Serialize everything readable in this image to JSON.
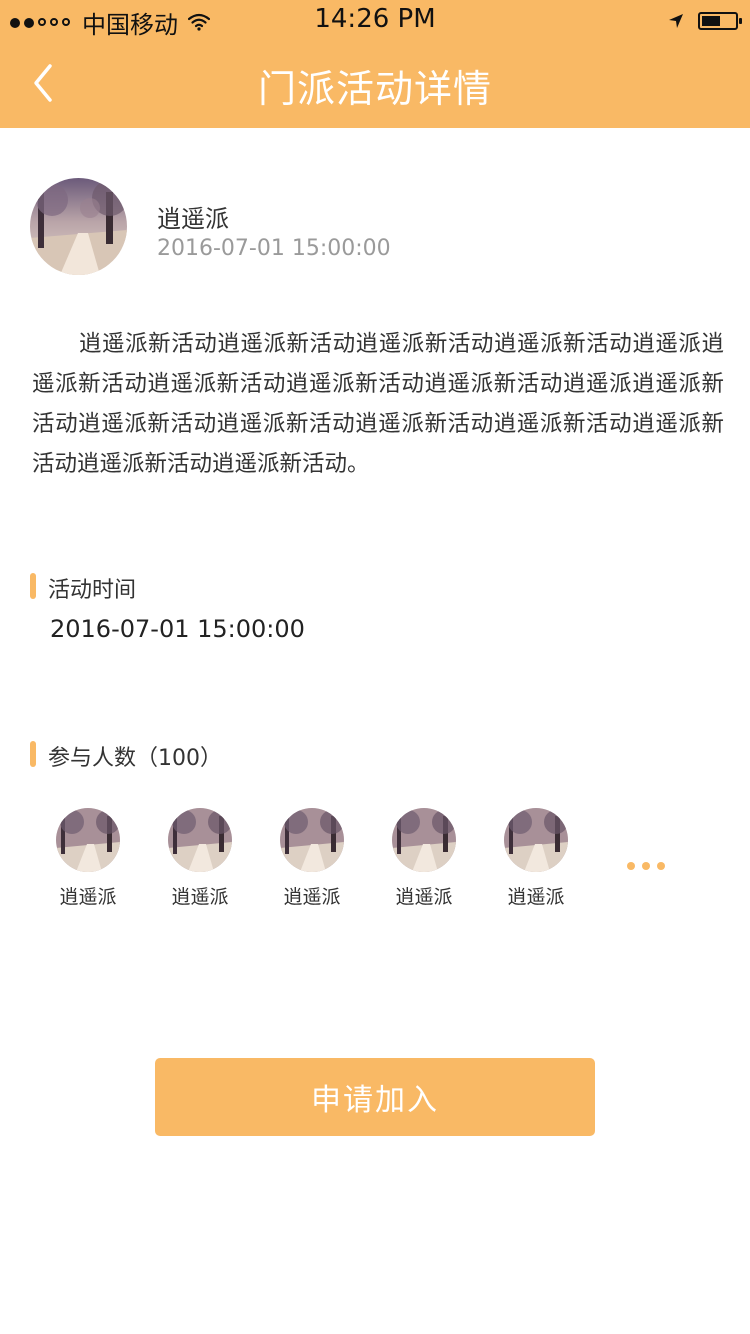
{
  "status_bar": {
    "carrier": "中国移动",
    "time": "14:26 PM",
    "signal_bars_filled": 2,
    "signal_bars_total": 5,
    "battery_level": 0.55
  },
  "nav": {
    "title": "门派活动详情",
    "back_icon": "chevron-left-icon"
  },
  "author": {
    "name": "逍遥派",
    "time": "2016-07-01 15:00:00"
  },
  "description": "逍遥派新活动逍遥派新活动逍遥派新活动逍遥派新活动逍遥派逍遥派新活动逍遥派新活动逍遥派新活动逍遥派新活动逍遥派逍遥派新活动逍遥派新活动逍遥派新活动逍遥派新活动逍遥派新活动逍遥派新活动逍遥派新活动逍遥派新活动。",
  "activity_time": {
    "label": "活动时间",
    "value": "2016-07-01 15:00:00"
  },
  "participants": {
    "label": "参与人数（100）",
    "items": [
      {
        "name": "逍遥派"
      },
      {
        "name": "逍遥派"
      },
      {
        "name": "逍遥派"
      },
      {
        "name": "逍遥派"
      },
      {
        "name": "逍遥派"
      }
    ],
    "more_icon": "more-dots-icon"
  },
  "join_button": {
    "label": "申请加入"
  },
  "colors": {
    "accent": "#f9b965",
    "text": "#333333",
    "muted": "#9a9a9a"
  }
}
